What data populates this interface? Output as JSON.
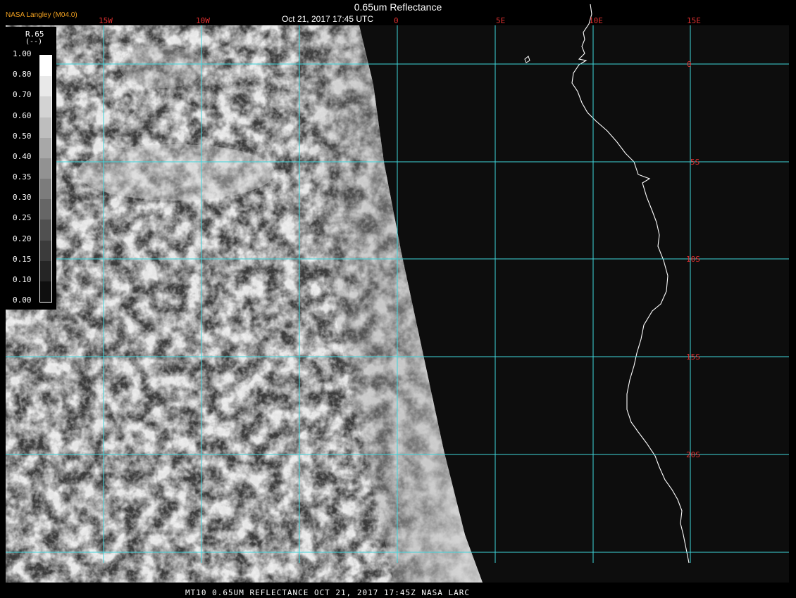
{
  "header": {
    "brand": "NASA Langley (M04.0)",
    "title": "0.65um Reflectance",
    "date": "Oct 21, 2017 17:45 UTC"
  },
  "footer": {
    "caption": "MT10  0.65UM REFLECTANCE   OCT 21, 2017 17:45Z   NASA LARC"
  },
  "legend": {
    "title": "R.65",
    "unit": "(--)",
    "ticks": [
      "1.00",
      "0.80",
      "0.70",
      "0.60",
      "0.50",
      "0.40",
      "0.35",
      "0.30",
      "0.25",
      "0.20",
      "0.15",
      "0.10",
      "0.00"
    ]
  },
  "map": {
    "lon_labels": [
      "15W",
      "10W",
      "0",
      "5E",
      "10E",
      "15E"
    ],
    "lat_labels": [
      "0",
      "5S",
      "10S",
      "15S",
      "20S"
    ],
    "colors": {
      "grid": "#3fd6dc",
      "grid_label": "#e03030",
      "coast": "#ffffff",
      "space": "#0d0d0d"
    }
  }
}
